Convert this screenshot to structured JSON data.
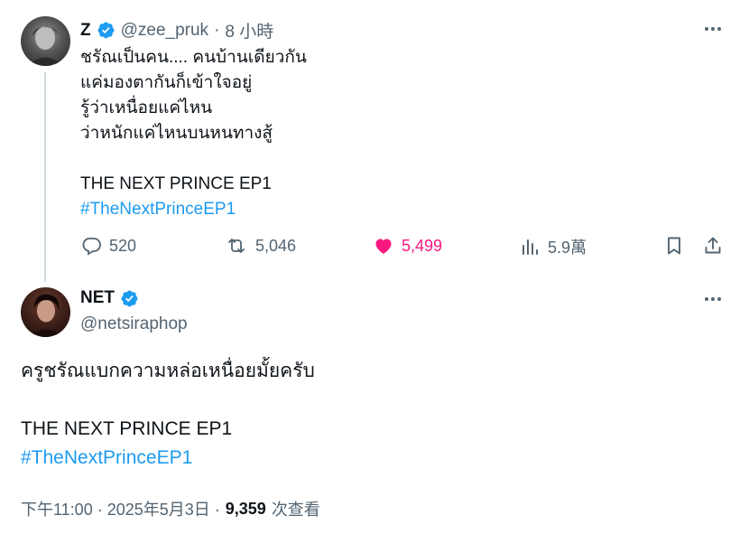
{
  "tweet1": {
    "name": "Z",
    "handle": "@zee_pruk",
    "separator": "·",
    "time": "8 小時",
    "lines": [
      "ชรัณเป็นคน.... คนบ้านเดียวกัน",
      "แค่มองตากันก็เข้าใจอยู่",
      "รู้ว่าเหนื่อยแค่ไหน",
      "ว่าหนักแค่ไหนบนหนทางสู้"
    ],
    "title_line": "THE NEXT PRINCE EP1",
    "hashtag": "#TheNextPrinceEP1",
    "actions": {
      "replies": "520",
      "reposts": "5,046",
      "likes": "5,499",
      "views": "5.9萬"
    },
    "colors": {
      "like": "#f91880",
      "verified": "#1d9bf0"
    }
  },
  "tweet2": {
    "name": "NET",
    "handle": "@netsiraphop",
    "text": "ครูชรัณแบกความหล่อเหนื่อยมั้ยครับ",
    "title_line": "THE NEXT PRINCE EP1",
    "hashtag": "#TheNextPrinceEP1",
    "footer": {
      "time": "下午11:00 · 2025年5月3日 ·",
      "views_count": "9,359",
      "views_label": "次查看"
    }
  },
  "icons": [
    "verified-badge-icon",
    "more-icon",
    "reply-icon",
    "repost-icon",
    "like-icon",
    "views-icon",
    "bookmark-icon",
    "share-icon"
  ]
}
